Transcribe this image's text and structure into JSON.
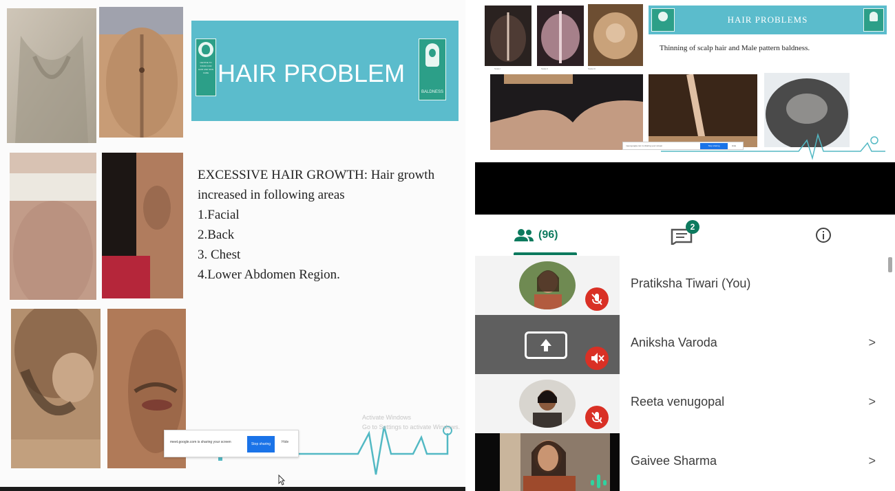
{
  "left_slide": {
    "banner_title": "HAIR PROBLEM",
    "left_logo_text": "CENTRE TO STAND FOR HAIR AND SKIN CARE",
    "right_logo_text": "BALDNESS",
    "content": {
      "heading": "EXCESSIVE HAIR GROWTH: Hair growth increased in following areas",
      "items": [
        "1.Facial",
        "2.Back",
        "3. Chest",
        "4.Lower Abdomen Region."
      ]
    },
    "share_bar": {
      "message": "meet.google.com is sharing your screen",
      "stop_label": "Stop sharing",
      "hide_label": "Hide"
    },
    "watermark": [
      "Activate Windows",
      "Go to Settings to activate Windows."
    ]
  },
  "right_panel": {
    "mini_slide": {
      "title": "HAIR PROBLEMS",
      "subtitle": "Thinning of scalp hair and Male pattern baldness.",
      "scale_labels": [
        "Scale I",
        "Scale II",
        "Scale III"
      ],
      "share_bar": {
        "message": "meet.google.com is sharing your screen",
        "stop_label": "Stop sharing",
        "hide_label": "Hide"
      }
    },
    "tabs": {
      "people_count": "(96)",
      "chat_badge": "2",
      "active_color": "#0d7a5e"
    },
    "participants": [
      {
        "name": "Pratiksha Tiwari (You)",
        "tile": "avatar",
        "muted": true,
        "chevron": ""
      },
      {
        "name": "Aniksha Varoda",
        "tile": "presenting",
        "muted": true,
        "chevron": ">"
      },
      {
        "name": "Reeta venugopal",
        "tile": "avatar",
        "muted": true,
        "chevron": ">"
      },
      {
        "name": "Gaivee Sharma",
        "tile": "video",
        "muted": false,
        "chevron": ">"
      }
    ],
    "colors": {
      "brand_teal": "#5bbccc",
      "mute_red": "#d93025",
      "tile_grey": "#5f5f5f"
    }
  }
}
